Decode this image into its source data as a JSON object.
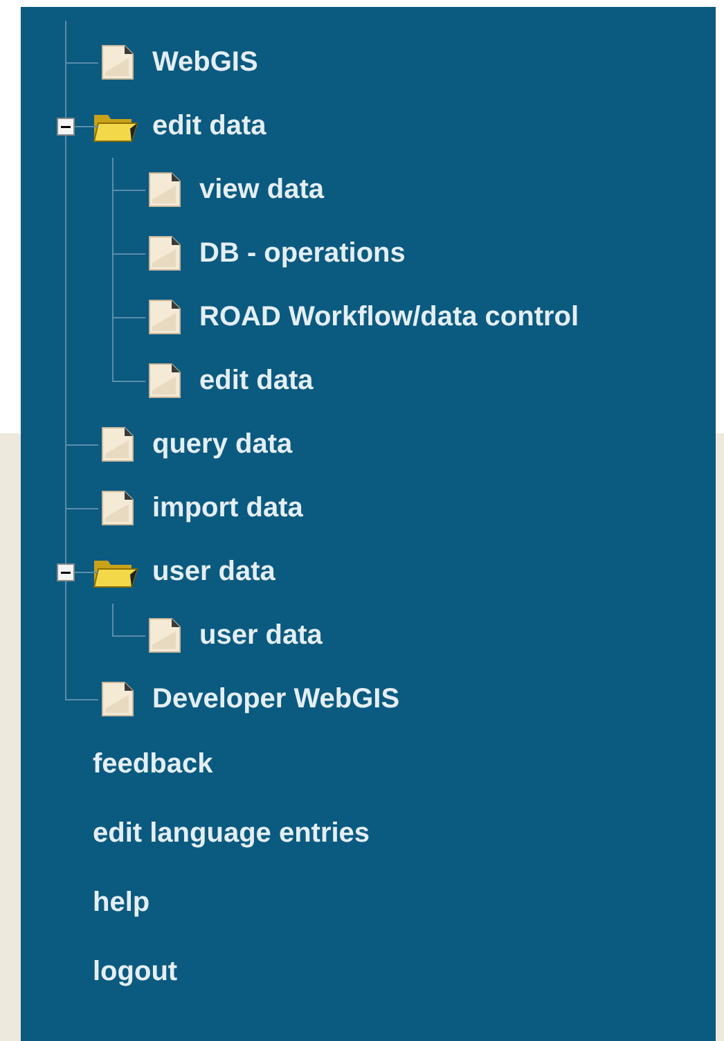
{
  "tree": [
    {
      "kind": "page",
      "label": "WebGIS"
    },
    {
      "kind": "folder",
      "label": "edit data",
      "expanded": true,
      "children": [
        {
          "kind": "page",
          "label": "view data"
        },
        {
          "kind": "page",
          "label": "DB - operations"
        },
        {
          "kind": "page",
          "label": "ROAD Workflow/data control"
        },
        {
          "kind": "page",
          "label": "edit data"
        }
      ]
    },
    {
      "kind": "page",
      "label": "query data"
    },
    {
      "kind": "page",
      "label": "import data"
    },
    {
      "kind": "folder",
      "label": "user data",
      "expanded": true,
      "children": [
        {
          "kind": "page",
          "label": "user data"
        }
      ]
    },
    {
      "kind": "page",
      "label": "Developer WebGIS"
    }
  ],
  "links": [
    "feedback",
    "edit language entries",
    "help",
    "logout"
  ]
}
